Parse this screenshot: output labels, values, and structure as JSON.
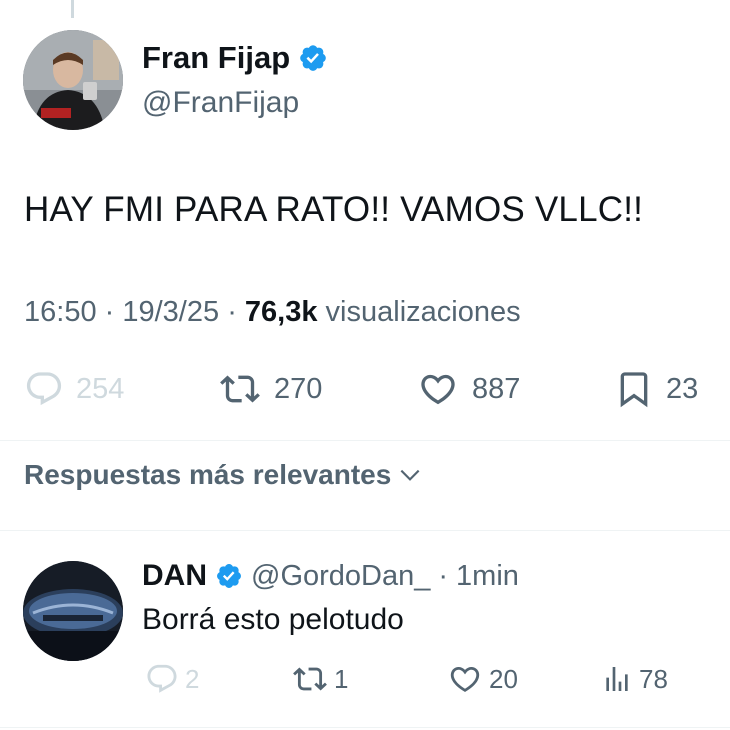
{
  "tweet": {
    "author_name": "Fran Fijap",
    "author_handle": "@FranFijap",
    "text": "HAY FMI PARA RATO!! VAMOS VLLC!!",
    "time": "16:50",
    "date": "19/3/25",
    "views_count": "76,3k",
    "views_label": "visualizaciones",
    "stats": {
      "replies": "254",
      "retweets": "270",
      "likes": "887",
      "bookmarks": "23"
    }
  },
  "sort": {
    "label": "Respuestas más relevantes"
  },
  "reply": {
    "author_name": "DAN",
    "author_handle": "@GordoDan_",
    "time": "1min",
    "text": "Borrá esto pelotudo",
    "stats": {
      "replies": "2",
      "retweets": "1",
      "likes": "20",
      "views": "78"
    }
  },
  "colors": {
    "verified": "#1d9bf0",
    "text_primary": "#0f1419",
    "text_secondary": "#536471",
    "muted": "#cfd9de"
  },
  "icons": [
    "verified-badge-icon",
    "reply-icon",
    "retweet-icon",
    "like-icon",
    "bookmark-icon",
    "chevron-down-icon",
    "views-icon"
  ]
}
